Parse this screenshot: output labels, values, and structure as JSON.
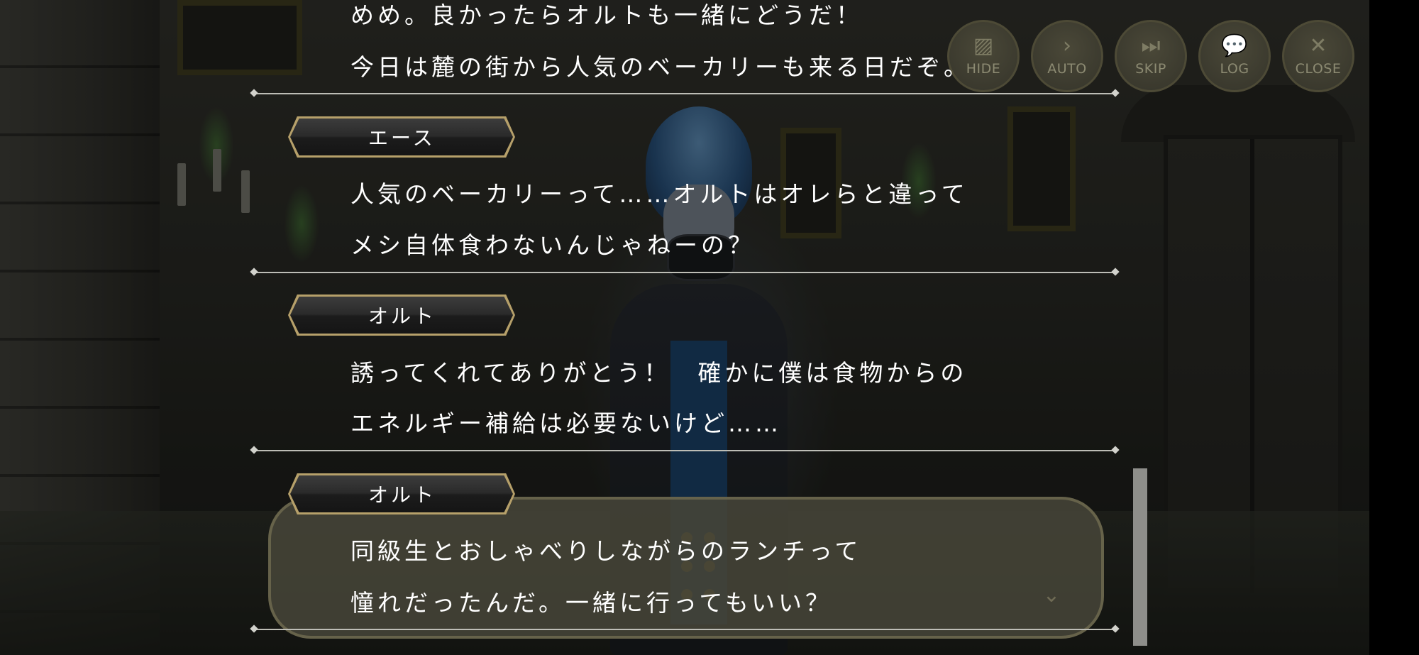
{
  "controls": {
    "hide": {
      "label": "HIDE",
      "icon": "hide-icon"
    },
    "auto": {
      "label": "AUTO",
      "icon": "auto-play-icon"
    },
    "skip": {
      "label": "SKIP",
      "icon": "skip-icon"
    },
    "log": {
      "label": "LOG",
      "icon": "log-icon"
    },
    "close": {
      "label": "CLOSE",
      "icon": "close-icon"
    }
  },
  "log": {
    "entry0": {
      "line1": "めめ。良かったらオルトも一緒にどうだ！",
      "line2": "今日は麓の街から人気のベーカリーも来る日だぞ。"
    },
    "entry1": {
      "speaker": "エース",
      "line1": "人気のベーカリーって……オルトはオレらと違って",
      "line2": "メシ自体食わないんじゃねーの？"
    },
    "entry2": {
      "speaker": "オルト",
      "line1": "誘ってくれてありがとう！　確かに僕は食物からの",
      "line2": "エネルギー補給は必要ないけど……"
    },
    "entry3": {
      "speaker": "オルト",
      "line1": "同級生とおしゃべりしながらのランチって",
      "line2": "憧れだったんだ。一緒に行ってもいい？"
    }
  },
  "colors": {
    "nametag_border": "#b6a06a",
    "text": "#ffffff",
    "button_text": "#8c8a72"
  }
}
